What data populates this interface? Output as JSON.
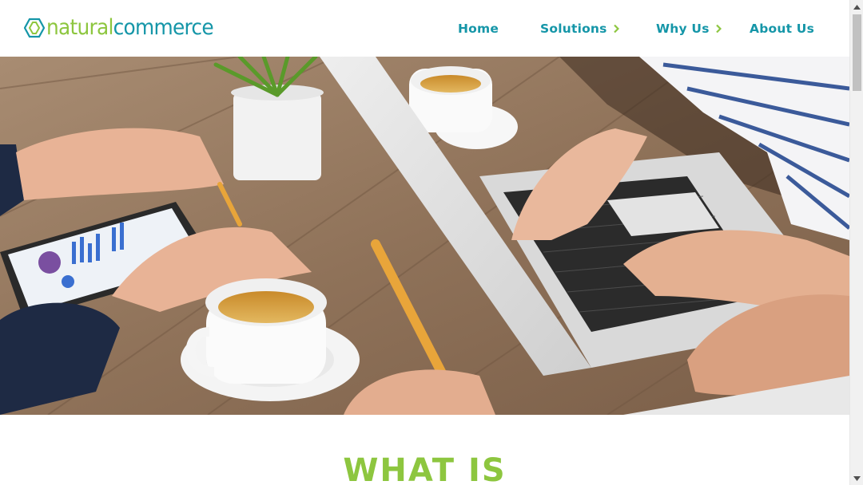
{
  "brand": {
    "logo_part1": "natural",
    "logo_part2": "commerce",
    "color_green": "#8dc63f",
    "color_teal": "#1596a8"
  },
  "nav": {
    "items": [
      {
        "label": "Home",
        "has_submenu": false
      },
      {
        "label": "Solutions",
        "has_submenu": true
      },
      {
        "label": "Why Us",
        "has_submenu": true
      },
      {
        "label": "About Us",
        "has_submenu": false
      }
    ],
    "chevron_icon": "chevron-right-icon"
  },
  "hero": {
    "image": "people-working-with-laptop-tablet-and-tea-photo"
  },
  "section": {
    "title": "WHAT IS"
  },
  "scrollbar": {
    "up_icon": "arrow-up-icon",
    "down_icon": "arrow-down-icon"
  }
}
